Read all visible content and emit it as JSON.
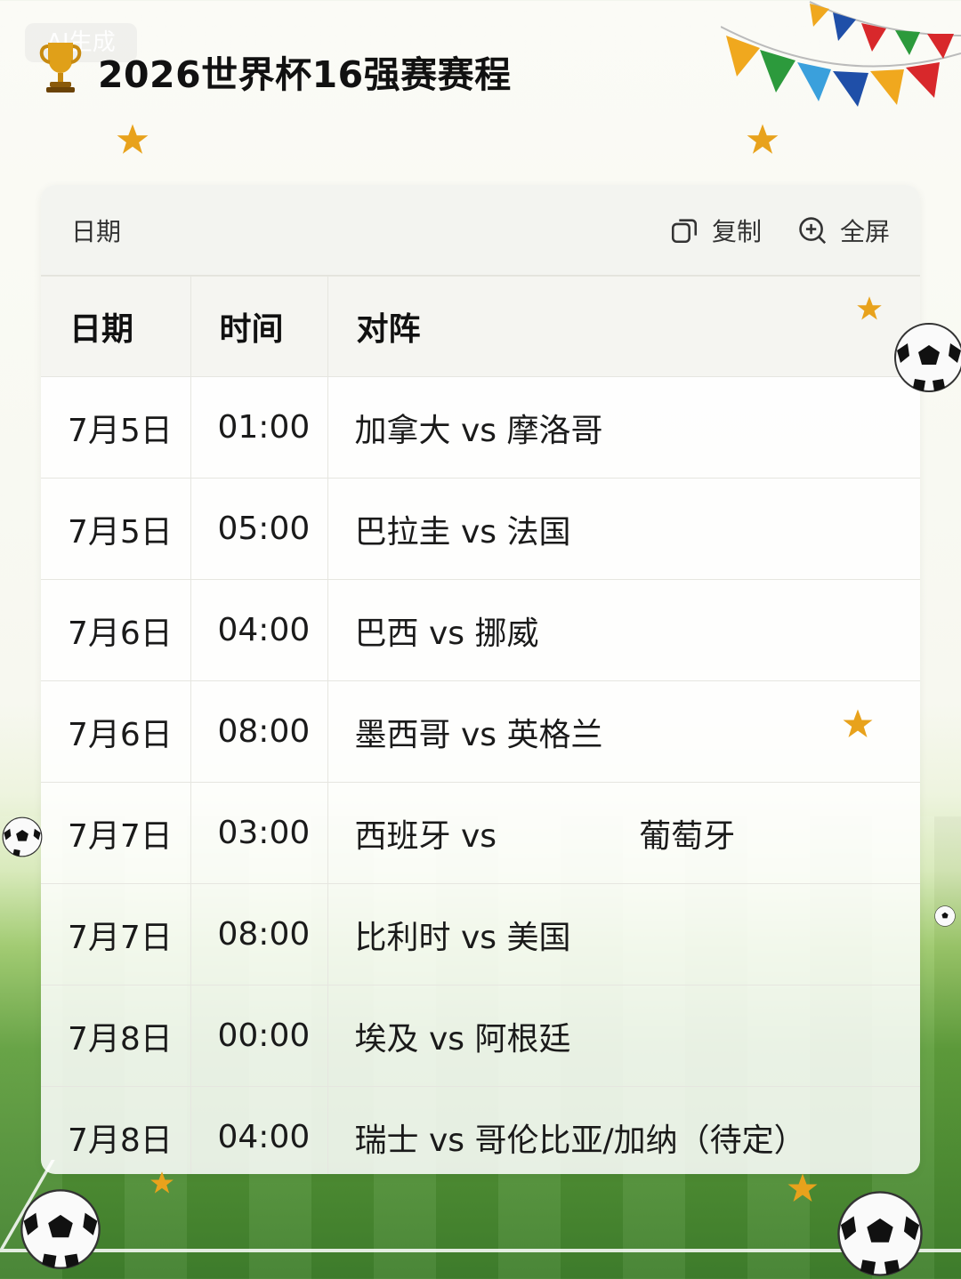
{
  "watermark": "AI生成",
  "page": {
    "title": "2026世界杯16强赛赛程"
  },
  "toolbar": {
    "label": "日期",
    "copy_label": "复制",
    "fullscreen_label": "全屏"
  },
  "table": {
    "headers": [
      "日期",
      "时间",
      "对阵"
    ],
    "rows": [
      {
        "date": "7月5日",
        "time": "01:00",
        "match": "加拿大 vs 摩洛哥"
      },
      {
        "date": "7月5日",
        "time": "05:00",
        "match": "巴拉圭 vs 法国"
      },
      {
        "date": "7月6日",
        "time": "04:00",
        "match": "巴西 vs 挪威"
      },
      {
        "date": "7月6日",
        "time": "08:00",
        "match": "墨西哥 vs 英格兰"
      },
      {
        "date": "7月7日",
        "time": "03:00",
        "match": "西班牙 vs              葡萄牙"
      },
      {
        "date": "7月7日",
        "time": "08:00",
        "match": "比利时 vs 美国"
      },
      {
        "date": "7月8日",
        "time": "00:00",
        "match": "埃及 vs 阿根廷"
      },
      {
        "date": "7月8日",
        "time": "04:00",
        "match": "瑞士 vs 哥伦比亚/加纳（待定）"
      }
    ]
  },
  "colors": {
    "accent_gold": "#e8a21c",
    "grass": "#4f8f34"
  }
}
